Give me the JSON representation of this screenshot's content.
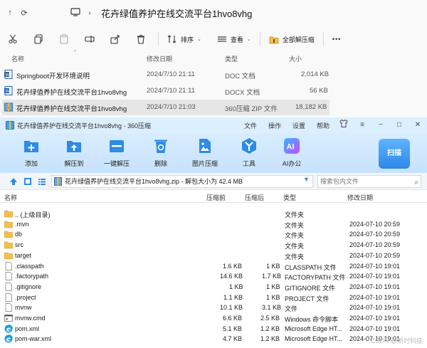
{
  "explorer": {
    "path": "花卉绿值养护在线交流平台1hvo8vhg",
    "toolbar": {
      "sort_label": "排序",
      "view_label": "查看",
      "extract_label": "全部解压缩",
      "more_label": "•••"
    },
    "columns": {
      "name": "名称",
      "date": "修改日期",
      "type": "类型",
      "size": "大小"
    },
    "rows": [
      {
        "name": "Springboot开发环境说明",
        "date": "2024/7/10 21:11",
        "type": "DOC 文档",
        "size": "2,014 KB",
        "icon": "word-doc-icon"
      },
      {
        "name": "花卉绿值养护在线交流平台1hvo8vhg",
        "date": "2024/7/10 21:11",
        "type": "DOCX 文档",
        "size": "56 KB",
        "icon": "word-docx-icon"
      },
      {
        "name": "花卉绿值养护在线交流平台1hvo8vhg",
        "date": "2024/7/10 21:03",
        "type": "360压缩 ZIP 文件",
        "size": "18,182 KB",
        "icon": "zip-archive-icon"
      }
    ]
  },
  "zip": {
    "title": "花卉绿值养护在线交流平台1hvo8vhg - 360压缩",
    "menus": [
      "文件",
      "操作",
      "设置",
      "帮助"
    ],
    "ribbon": [
      {
        "label": "添加",
        "icon": "add-icon"
      },
      {
        "label": "解压到",
        "icon": "extract-to-icon"
      },
      {
        "label": "一键解压",
        "icon": "one-click-extract-icon"
      },
      {
        "label": "删除",
        "icon": "delete-icon"
      },
      {
        "label": "图片压缩",
        "icon": "image-compress-icon"
      },
      {
        "label": "工具",
        "icon": "tools-icon"
      },
      {
        "label": "AI办公",
        "icon": "ai-office-icon"
      }
    ],
    "scan_label": "扫描",
    "address": "花卉绿值养护在线交流平台1hvo8vhg.zip - 解包大小为 42.4 MB",
    "search_placeholder": "搜索包内文件",
    "columns": {
      "name": "名称",
      "compressed": "压缩前",
      "packed": "压缩后",
      "type": "类型",
      "date": "修改日期"
    },
    "rows": [
      {
        "name": ".. (上级目录)",
        "before": "",
        "after": "",
        "type": "文件夹",
        "date": "",
        "icon": "folder-icon"
      },
      {
        "name": ".mvn",
        "before": "",
        "after": "",
        "type": "文件夹",
        "date": "2024-07-10 20:59",
        "icon": "folder-icon"
      },
      {
        "name": "db",
        "before": "",
        "after": "",
        "type": "文件夹",
        "date": "2024-07-10 20:59",
        "icon": "folder-icon"
      },
      {
        "name": "src",
        "before": "",
        "after": "",
        "type": "文件夹",
        "date": "2024-07-10 20:59",
        "icon": "folder-icon"
      },
      {
        "name": "target",
        "before": "",
        "after": "",
        "type": "文件夹",
        "date": "2024-07-10 20:59",
        "icon": "folder-icon"
      },
      {
        "name": ".classpath",
        "before": "1.6 KB",
        "after": "1 KB",
        "type": "CLASSPATH 文件",
        "date": "2024-07-10 19:01",
        "icon": "file-icon"
      },
      {
        "name": ".factorypath",
        "before": "14.6 KB",
        "after": "1.7 KB",
        "type": "FACTORYPATH 文件",
        "date": "2024-07-10 19:01",
        "icon": "file-icon"
      },
      {
        "name": ".gitignore",
        "before": "1 KB",
        "after": "1 KB",
        "type": "GITIGNORE 文件",
        "date": "2024-07-10 19:01",
        "icon": "file-icon"
      },
      {
        "name": ".project",
        "before": "1.1 KB",
        "after": "1 KB",
        "type": "PROJECT 文件",
        "date": "2024-07-10 19:01",
        "icon": "file-icon"
      },
      {
        "name": "mvnw",
        "before": "10.1 KB",
        "after": "3.1 KB",
        "type": "文件",
        "date": "2024-07-10 19:01",
        "icon": "file-icon"
      },
      {
        "name": "mvnw.cmd",
        "before": "6.6 KB",
        "after": "2.5 KB",
        "type": "Windows 命令脚本",
        "date": "2024-07-10 19:01",
        "icon": "cmd-file-icon"
      },
      {
        "name": "pom.xml",
        "before": "5.1 KB",
        "after": "1.2 KB",
        "type": "Microsoft Edge HT...",
        "date": "2024-07-10 19:01",
        "icon": "edge-icon"
      },
      {
        "name": "pom-war.xml",
        "before": "4.7 KB",
        "after": "1.2 KB",
        "type": "Microsoft Edge HT...",
        "date": "2024-07-10 19:01",
        "icon": "edge-icon"
      }
    ]
  },
  "watermark": "CSDN @新时科技"
}
